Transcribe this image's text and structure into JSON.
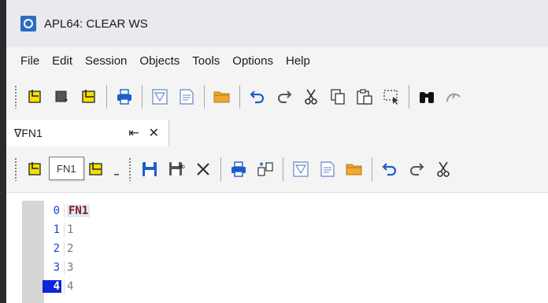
{
  "window": {
    "title": "APL64: CLEAR WS"
  },
  "menu": {
    "items": [
      "File",
      "Edit",
      "Session",
      "Objects",
      "Tools",
      "Options",
      "Help"
    ]
  },
  "toolbar": {
    "buttons": [
      "new-function-icon",
      "new-variable-icon",
      "open-editor-icon",
      "print-icon",
      "new-page-icon",
      "document-icon",
      "folder-icon",
      "undo-icon",
      "redo-icon",
      "cut-icon",
      "copy-icon",
      "paste-icon",
      "select-icon",
      "find-icon",
      "help-icon"
    ]
  },
  "editor_tab": {
    "label": "∇FN1",
    "pin_glyph": "⇤",
    "close_glyph": "✕"
  },
  "tooltip": {
    "text": "FN1"
  },
  "editor": {
    "lines": [
      {
        "num": "0",
        "code": "FN1",
        "kind": "header",
        "active": false
      },
      {
        "num": "1",
        "code": "1",
        "kind": "body",
        "active": false
      },
      {
        "num": "2",
        "code": "2",
        "kind": "body",
        "active": false
      },
      {
        "num": "3",
        "code": "3",
        "kind": "body",
        "active": false
      },
      {
        "num": "4",
        "code": "4",
        "kind": "body",
        "active": true
      }
    ]
  },
  "colors": {
    "line_number": "#1f3fd1",
    "active_line_bg": "#0b25d8",
    "header_code": "#8b1a1a",
    "body_code": "#7a7a7a",
    "accent_yellow": "#f4e000"
  }
}
